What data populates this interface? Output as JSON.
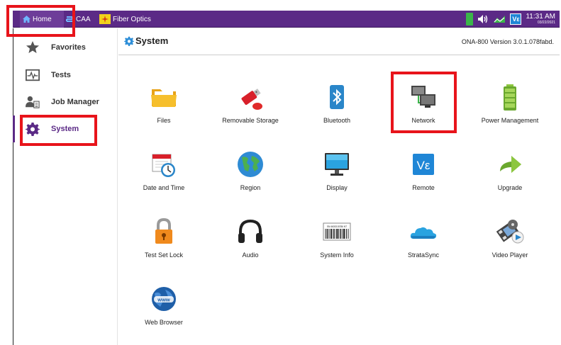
{
  "topbar": {
    "tabs": [
      {
        "label": "Home",
        "icon": "home-icon"
      },
      {
        "label": "CAA",
        "icon": "caa-icon"
      },
      {
        "label": "Fiber Optics",
        "icon": "fiber-optics-icon"
      }
    ],
    "status_icons": [
      "battery-icon",
      "speaker-icon",
      "network-status-icon",
      "vc-remote-icon"
    ],
    "time": "11:31 AM",
    "date": "03/22/2021"
  },
  "sidebar": {
    "items": [
      {
        "label": "Favorites",
        "icon": "star-icon"
      },
      {
        "label": "Tests",
        "icon": "tests-icon"
      },
      {
        "label": "Job Manager",
        "icon": "job-manager-icon"
      },
      {
        "label": "System",
        "icon": "gear-icon",
        "active": true
      }
    ]
  },
  "header": {
    "title": "System",
    "version": "ONA-800 Version 3.0.1.078fabd."
  },
  "grid": {
    "items": [
      {
        "label": "Files",
        "icon": "folder-icon"
      },
      {
        "label": "Removable Storage",
        "icon": "usb-drive-icon"
      },
      {
        "label": "Bluetooth",
        "icon": "bluetooth-icon"
      },
      {
        "label": "Network",
        "icon": "network-icon"
      },
      {
        "label": "Power Management",
        "icon": "battery-icon"
      },
      {
        "label": "Date and Time",
        "icon": "calendar-clock-icon"
      },
      {
        "label": "Region",
        "icon": "globe-icon"
      },
      {
        "label": "Display",
        "icon": "monitor-icon"
      },
      {
        "label": "Remote",
        "icon": "vc-remote-icon"
      },
      {
        "label": "Upgrade",
        "icon": "upgrade-arrow-icon"
      },
      {
        "label": "Test Set Lock",
        "icon": "padlock-icon"
      },
      {
        "label": "Audio",
        "icon": "headphones-icon"
      },
      {
        "label": "System Info",
        "icon": "barcode-icon"
      },
      {
        "label": "StrataSync",
        "icon": "cloud-icon"
      },
      {
        "label": "Video Player",
        "icon": "video-player-icon"
      },
      {
        "label": "Web Browser",
        "icon": "web-browser-icon"
      }
    ],
    "barcode_text": "SN 6603315786 NT"
  },
  "vc_mark": "Vε",
  "colors": {
    "topbar": "#5b2a86",
    "accent": "#5b2a86",
    "highlight": "#e8141b"
  }
}
